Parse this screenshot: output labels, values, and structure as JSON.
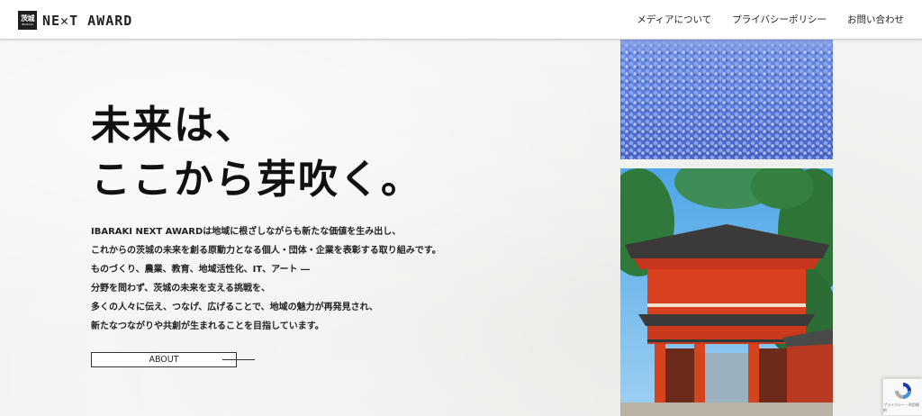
{
  "header": {
    "logo_kanji": "茨城",
    "logo_sub": "IBARAKI",
    "logo_text": "NE✕T AWARD",
    "nav": [
      {
        "label": "メディアについて"
      },
      {
        "label": "プライバシーポリシー"
      },
      {
        "label": "お問い合わせ"
      }
    ]
  },
  "hero": {
    "headline_line1": "未来は、",
    "headline_line2": "ここから芽吹く。",
    "body_lines": [
      "IBARAKI NEXT AWARDは地域に根ざしながらも新たな価値を生み出し、",
      "これからの茨城の未来を創る原動力となる個人・団体・企業を表彰する取り組みです。",
      "ものづくり、農業、教育、地域活性化、IT、アート ―",
      "分野を問わず、茨城の未来を支える挑戦を、",
      "多くの人々に伝え、つなげ、広げることで、地域の魅力が再発見され、",
      "新たなつながりや共創が生まれることを目指しています。"
    ],
    "about_label": "ABOUT"
  },
  "images": {
    "top": "blue-nemophila-field-photo",
    "bottom": "red-shrine-gate-photo"
  },
  "recaptcha": {
    "icon": "recaptcha-icon",
    "text": "プライバシー・利用規約"
  }
}
